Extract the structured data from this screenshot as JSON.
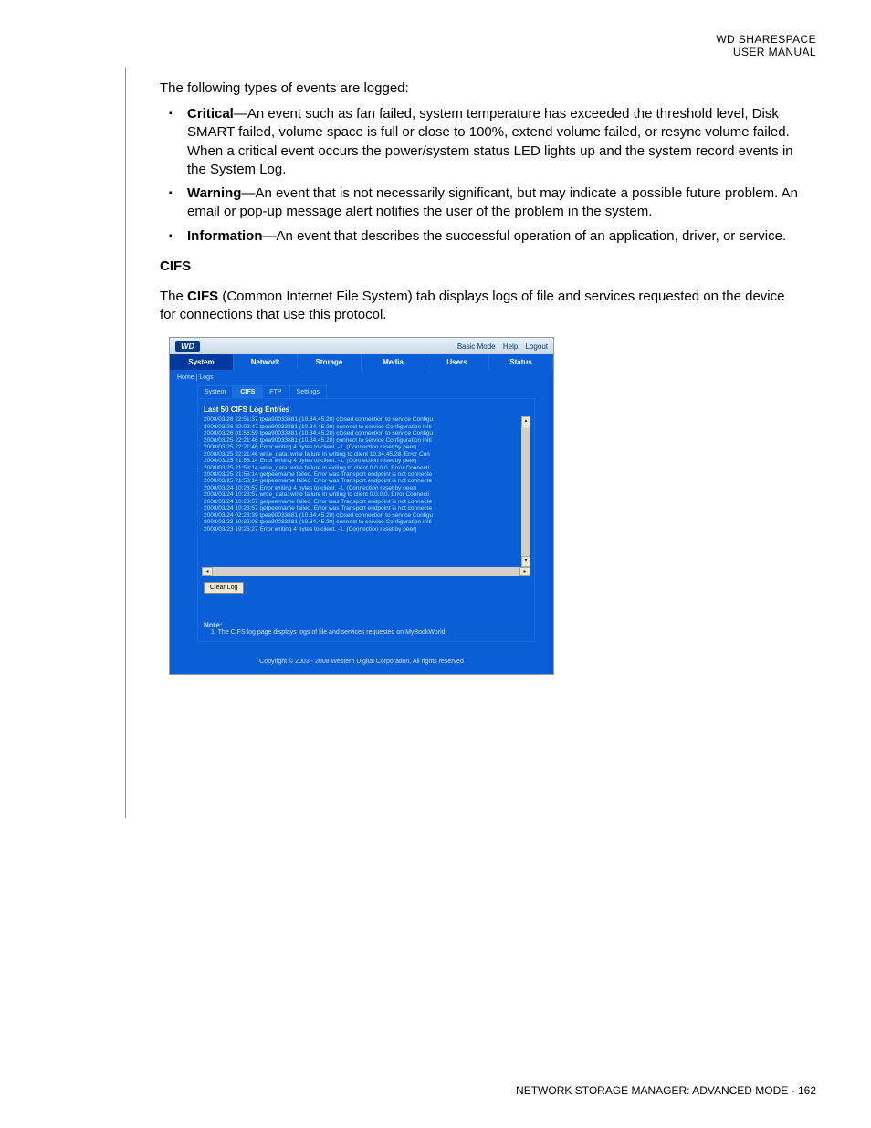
{
  "header": {
    "line1": "WD SHARESPACE",
    "line2": "USER MANUAL"
  },
  "intro": "The following types of events are logged:",
  "events": [
    {
      "term": "Critical",
      "desc": "—An event such as fan failed, system temperature has exceeded the threshold level, Disk SMART failed, volume space is full or close to 100%, extend volume failed, or resync volume failed. When a critical event occurs the power/system status LED lights up and the system record events in the System Log."
    },
    {
      "term": "Warning",
      "desc": "—An event that is not necessarily significant, but may indicate a possible future problem. An email or pop-up message alert notifies the user of the problem in the system."
    },
    {
      "term": "Information",
      "desc": "—An event that describes the successful operation of an application, driver, or service."
    }
  ],
  "cifs_heading": "CIFS",
  "cifs_para_pre": "The ",
  "cifs_para_bold": "CIFS",
  "cifs_para_post": " (Common Internet File System) tab displays logs of file and services requested on the device for connections that use this protocol.",
  "screenshot": {
    "logo": "WD",
    "top_links": [
      "Basic Mode",
      "Help",
      "Logout"
    ],
    "main_tabs": [
      "System",
      "Network",
      "Storage",
      "Media",
      "Users",
      "Status"
    ],
    "breadcrumb": "Home | Logs",
    "sub_tabs": [
      "System",
      "CIFS",
      "FTP",
      "Settings"
    ],
    "panel_title": "Last 50 CIFS Log Entries",
    "log_rows": [
      "2008/03/26 22:51:37  tpea90033881 (10.34.45.28) closed connection to service Configu",
      "2008/03/26 22:02:47  tpea90033881 (10.34.45.28) connect to service Configuration initi",
      "2008/03/26 01:56:59  tpea90033881 (10.34.45.28) closed connection to service Configu",
      "2008/03/25 22:21:46  tpea90033881 (10.34.45.28) connect to service Configuration initi",
      "2008/03/25 22:21:46  Error writing 4 bytes to client. -1. (Connection reset by peer)",
      "2008/03/25 22:21:46  write_data: write failure in writing to client 10.34.45.28. Error Con",
      "2008/03/25 21:58:14  Error writing 4 bytes to client. -1. (Connection reset by peer)",
      "2008/03/25 21:58:14  write_data: write failure in writing to client 0.0.0.0. Error Connecti",
      "2008/03/25 21:58:14  getpeername failed. Error was Transport endpoint is not connecte",
      "2008/03/25 21:58:14  getpeername failed. Error was Transport endpoint is not connecte",
      "2008/03/24 10:23:57  Error writing 4 bytes to client. -1. (Connection reset by peer)",
      "2008/03/24 10:23:57  write_data: write failure in writing to client 0.0.0.0. Error Connecti",
      "2008/03/24 10:23:57  getpeername failed. Error was Transport endpoint is not connecte",
      "2008/03/24 10:23:57  getpeername failed. Error was Transport endpoint is not connecte",
      "2008/03/24 02:28:39  tpea90033881 (10.34.45.28) closed connection to service Configu",
      "2008/03/23 19:32:08  tpea90033881 (10.34.45.28) connect to service Configuration initi",
      "2008/03/23 19:26:27  Error writing 4 bytes to client. -1. (Connection reset by peer)"
    ],
    "clear_btn": "Clear Log",
    "note_h": "Note:",
    "note_t": "1.  The CIFS log page displays logs of file and services requested on MyBookWorld.",
    "copyright": "Copyright © 2003 - 2008 Western Digital Corporation, All rights reserved"
  },
  "footer": "NETWORK STORAGE MANAGER: ADVANCED MODE - 162"
}
